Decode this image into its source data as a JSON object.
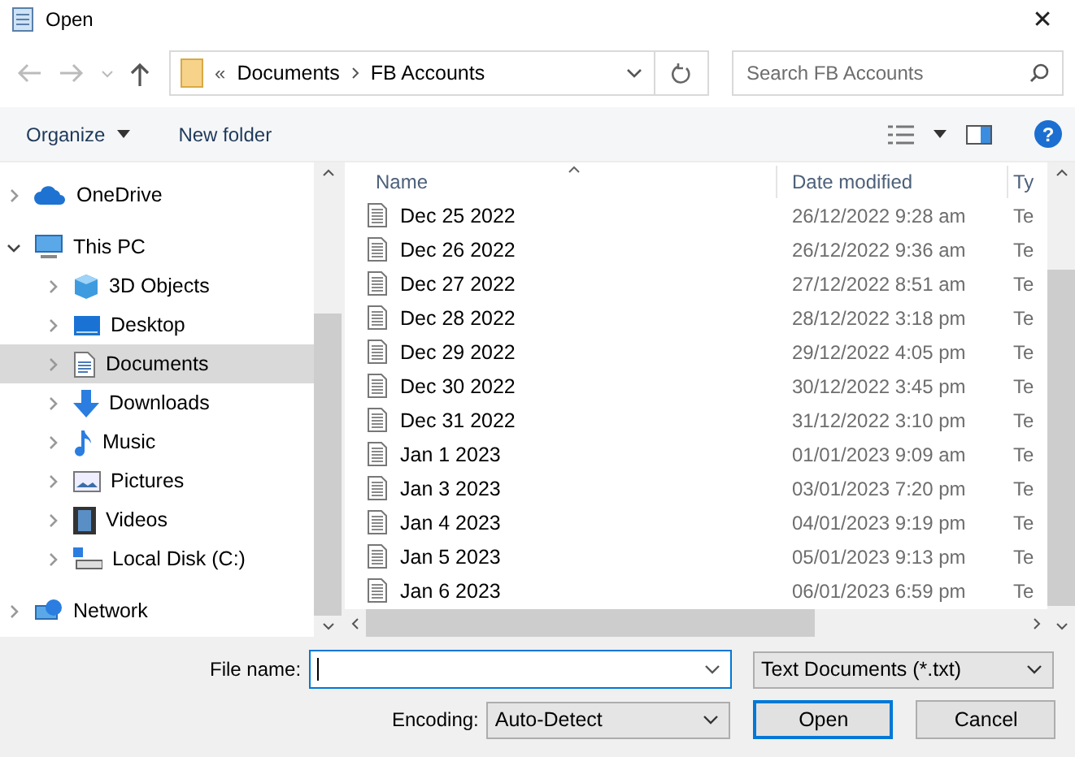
{
  "window": {
    "title": "Open",
    "close": "✕"
  },
  "nav": {
    "breadcrumb_overflow": "«",
    "path": [
      "Documents",
      "FB Accounts"
    ],
    "search": {
      "placeholder": "Search FB Accounts"
    }
  },
  "toolbar": {
    "organize": "Organize",
    "new_folder": "New folder",
    "help": "?"
  },
  "sidebar": {
    "items": [
      {
        "label": "OneDrive",
        "kind": "cloud",
        "expanded": false,
        "selected": false
      },
      {
        "label": "This PC",
        "kind": "computer",
        "expanded": true,
        "selected": false,
        "children": [
          {
            "label": "3D Objects",
            "kind": "cube",
            "expanded": false,
            "selected": false
          },
          {
            "label": "Desktop",
            "kind": "desktop",
            "expanded": false,
            "selected": false
          },
          {
            "label": "Documents",
            "kind": "documents",
            "expanded": false,
            "selected": true
          },
          {
            "label": "Downloads",
            "kind": "downloads",
            "expanded": false,
            "selected": false
          },
          {
            "label": "Music",
            "kind": "music",
            "expanded": false,
            "selected": false
          },
          {
            "label": "Pictures",
            "kind": "pictures",
            "expanded": false,
            "selected": false
          },
          {
            "label": "Videos",
            "kind": "videos",
            "expanded": false,
            "selected": false
          },
          {
            "label": "Local Disk (C:)",
            "kind": "disk",
            "expanded": false,
            "selected": false
          }
        ]
      },
      {
        "label": "Network",
        "kind": "network",
        "expanded": false,
        "selected": false
      }
    ]
  },
  "table": {
    "columns": [
      "Name",
      "Date modified",
      "Ty"
    ],
    "rows": [
      {
        "name": "Dec 25 2022",
        "date": "26/12/2022 9:28 am",
        "type": "Te"
      },
      {
        "name": "Dec 26 2022",
        "date": "26/12/2022 9:36 am",
        "type": "Te"
      },
      {
        "name": "Dec 27 2022",
        "date": "27/12/2022 8:51 am",
        "type": "Te"
      },
      {
        "name": "Dec 28 2022",
        "date": "28/12/2022 3:18 pm",
        "type": "Te"
      },
      {
        "name": "Dec 29 2022",
        "date": "29/12/2022 4:05 pm",
        "type": "Te"
      },
      {
        "name": "Dec 30 2022",
        "date": "30/12/2022 3:45 pm",
        "type": "Te"
      },
      {
        "name": "Dec 31 2022",
        "date": "31/12/2022 3:10 pm",
        "type": "Te"
      },
      {
        "name": "Jan 1 2023",
        "date": "01/01/2023 9:09 am",
        "type": "Te"
      },
      {
        "name": "Jan 3 2023",
        "date": "03/01/2023 7:20 pm",
        "type": "Te"
      },
      {
        "name": "Jan 4 2023",
        "date": "04/01/2023 9:19 pm",
        "type": "Te"
      },
      {
        "name": "Jan 5 2023",
        "date": "05/01/2023 9:13 pm",
        "type": "Te"
      },
      {
        "name": "Jan 6 2023",
        "date": "06/01/2023 6:59 pm",
        "type": "Te"
      }
    ]
  },
  "footer": {
    "file_name_label": "File name:",
    "file_type": "Text Documents (*.txt)",
    "encoding_label": "Encoding:",
    "encoding": "Auto-Detect",
    "buttons": [
      "Open",
      "Cancel"
    ]
  }
}
